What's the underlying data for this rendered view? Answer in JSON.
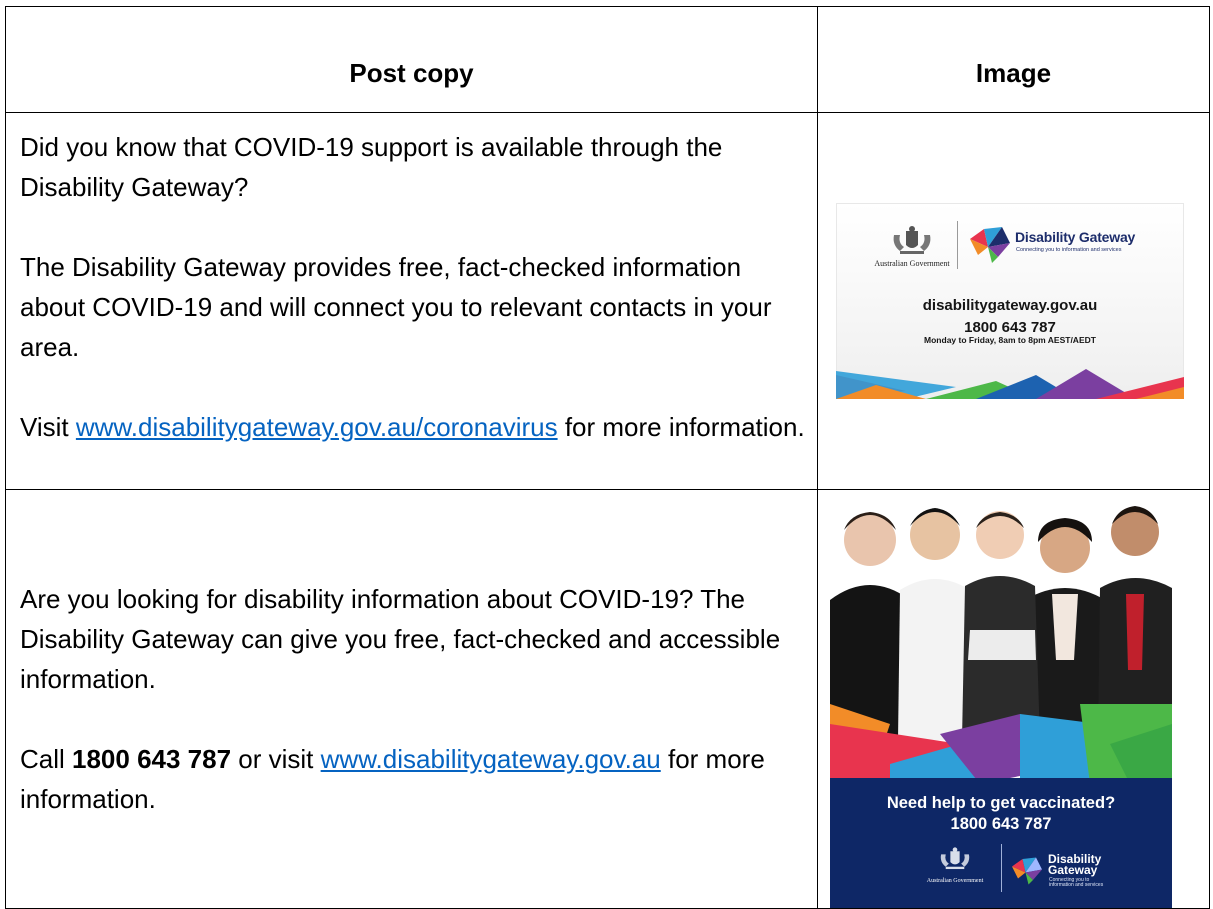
{
  "table": {
    "header": {
      "post_copy": "Post copy",
      "image": "Image"
    },
    "rows": [
      {
        "paragraphs": [
          "Did you know that COVID-19 support is available through the Disability Gateway?",
          "The Disability Gateway provides free, fact-checked information about COVID-19 and will connect you to relevant contacts in your area."
        ],
        "visit_prefix": "Visit ",
        "visit_link": "www.disabilitygateway.gov.au/coronavirus",
        "visit_suffix": " for more information.",
        "image": {
          "gov_label": "Australian Government",
          "brand": "Disability Gateway",
          "brand_tagline": "Connecting you to information and services",
          "url": "disabilitygateway.gov.au",
          "phone": "1800 643 787",
          "hours": "Monday to Friday, 8am to 8pm AEST/AEDT"
        }
      },
      {
        "paragraph": "Are you looking for disability information about COVID-19? The Disability Gateway can give you free, fact-checked and accessible information.",
        "call_prefix": "Call ",
        "call_phone": "1800 643 787",
        "call_middle": " or visit ",
        "call_link": "www.disabilitygateway.gov.au",
        "call_suffix": " for more information.",
        "image": {
          "headline": "Need help to get vaccinated?",
          "phone": "1800 643 787",
          "gov_label": "Australian Government",
          "brand_line1": "Disability",
          "brand_line2": "Gateway",
          "brand_tagline_1": "Connecting you to",
          "brand_tagline_2": "information and services"
        }
      }
    ]
  },
  "colors": {
    "link": "#0563c1",
    "navy": "#0e2766",
    "brand_text": "#1d2d6b"
  }
}
